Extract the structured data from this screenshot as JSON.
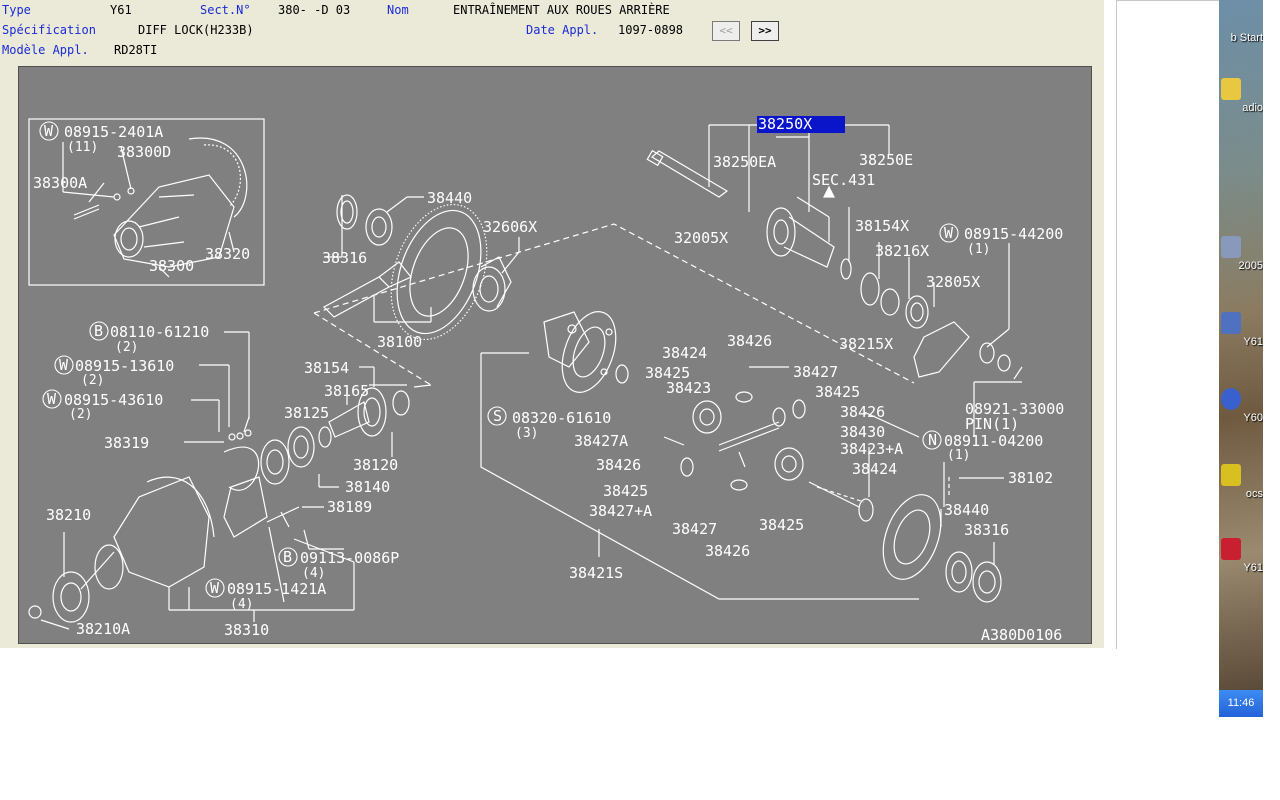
{
  "header": {
    "type_label": "Type",
    "type_value": "Y61",
    "sect_label": "Sect.N°",
    "sect_value": "380-  -D 03",
    "nom_label": "Nom",
    "nom_value": "ENTRAÎNEMENT AUX ROUES ARRIÈRE",
    "spec_label": "Spécification",
    "spec_value": "DIFF LOCK(H233B)",
    "date_label": "Date Appl.",
    "date_value": "1097-0898",
    "model_label": "Modèle Appl.",
    "model_value": "RD28TI",
    "prev_button": "<<",
    "next_button": ">>"
  },
  "drawing": {
    "code": "A380D0106",
    "selected_part": "38250X",
    "inset": {
      "w1": "08915-2401A",
      "w1_qty": "(11)",
      "p1": "38300D",
      "p2": "38300A",
      "p3": "38300",
      "p4": "38320"
    },
    "labels": {
      "p38440a": "38440",
      "p38316a": "38316",
      "p38100": "38100",
      "p32606x": "32606X",
      "p38250ea": "38250EA",
      "p38250e": "38250E",
      "sec431": "SEC.431",
      "p32005x": "32005X",
      "p38154x": "38154X",
      "p38216x": "38216X",
      "w08915_44200": "08915-44200",
      "w08915_44200_qty": "(1)",
      "p32805x": "32805X",
      "p38215x": "38215X",
      "b08110": "08110-61210",
      "b08110_qty": "(2)",
      "w08915_13610": "08915-13610",
      "w08915_13610_qty": "(2)",
      "w08915_43610": "08915-43610",
      "w08915_43610_qty": "(2)",
      "p38319": "38319",
      "p38154": "38154",
      "p38165": "38165",
      "p38125": "38125",
      "p38120": "38120",
      "p38140": "38140",
      "p38189": "38189",
      "p38210": "38210",
      "p38210a": "38210A",
      "p38310": "38310",
      "b09113": "09113-0086P",
      "b09113_qty": "(4)",
      "w08915_1421a": "08915-1421A",
      "w08915_1421a_qty": "(4)",
      "p38424a": "38424",
      "p38426a": "38426",
      "p38425a": "38425",
      "p38427": "38427",
      "p38423": "38423",
      "p38425b": "38425",
      "p38426b": "38426",
      "s08320": "08320-61610",
      "s08320_qty": "(3)",
      "p38427a": "38427A",
      "p38430": "38430",
      "p38423a": "38423+A",
      "p38426c": "38426",
      "p38425c": "38425",
      "p38427a2": "38427+A",
      "p38424b": "38424",
      "p38427b": "38427",
      "p38425d": "38425",
      "p38426d": "38426",
      "p38421s": "38421S",
      "p08921": "08921-33000",
      "pin": "PIN(1)",
      "n08911": "08911-04200",
      "n08911_qty": "(1)",
      "p38102": "38102",
      "p38440b": "38440",
      "p38316b": "38316"
    }
  },
  "desktop": {
    "icons": [
      {
        "label": "b Start",
        "color": "#4a7bd6"
      },
      {
        "label": "adio",
        "color": "#e8c840"
      },
      {
        "label": "2005",
        "color": "#8899bb"
      },
      {
        "label": "Y61",
        "color": "#5070c0"
      },
      {
        "label": "Y60",
        "color": "#3a60d0"
      },
      {
        "label": "ocs",
        "color": "#d8c020"
      },
      {
        "label": "Y61",
        "color": "#c82030"
      }
    ],
    "clock": "11:46"
  }
}
